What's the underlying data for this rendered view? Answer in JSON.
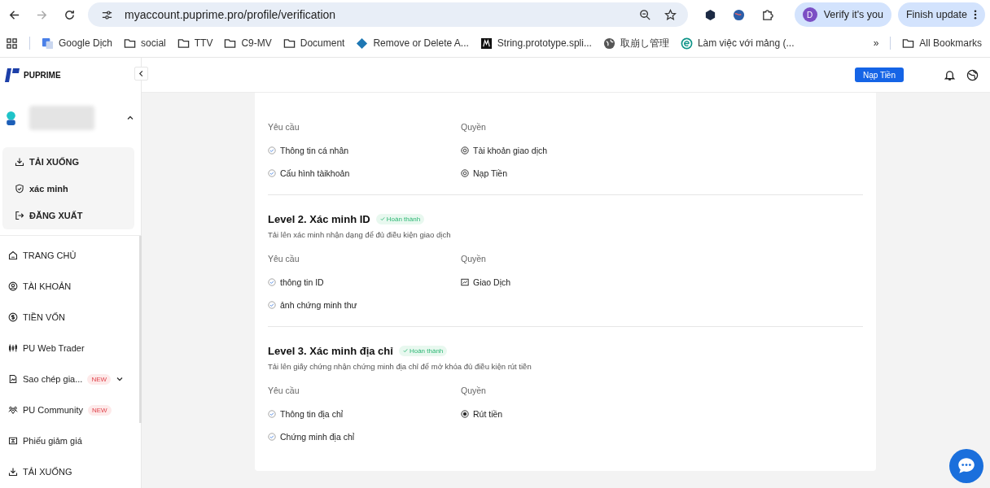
{
  "browser": {
    "url": "myaccount.puprime.pro/profile/verification",
    "forward_disabled": true,
    "profile": {
      "initial": "D",
      "label": "Verify it's you"
    },
    "update_label": "Finish update",
    "bookmarks": [
      {
        "kind": "translate",
        "label": "Google Dịch"
      },
      {
        "kind": "folder",
        "label": "social"
      },
      {
        "kind": "folder",
        "label": "TTV"
      },
      {
        "kind": "folder",
        "label": "C9-MV"
      },
      {
        "kind": "folder",
        "label": "Document"
      },
      {
        "kind": "diamond",
        "label": "Remove or Delete A..."
      },
      {
        "kind": "dark",
        "label": "String.prototype.spli..."
      },
      {
        "kind": "globe",
        "label": "取崩し管理"
      },
      {
        "kind": "circle",
        "label": "Làm việc với mảng (..."
      }
    ],
    "overflow": "»",
    "all_bookmarks": "All Bookmarks"
  },
  "sidebar": {
    "brand": "PUPRIME",
    "account_menu_expanded": true,
    "account_menu": [
      {
        "label": "TẢI XUỐNG"
      },
      {
        "label": "xác minh"
      },
      {
        "label": "ĐĂNG XUẤT"
      }
    ],
    "items": [
      {
        "label": "TRANG CHỦ",
        "kind": "link"
      },
      {
        "label": "TÀI KHOẢN",
        "kind": "link"
      },
      {
        "label": "TIỀN VỐN",
        "kind": "link"
      },
      {
        "label": "PU Web Trader",
        "kind": "link"
      },
      {
        "label": "Sao chép gia...",
        "kind": "group",
        "badge": "NEW"
      },
      {
        "label": "PU Community",
        "kind": "link",
        "badge": "NEW"
      },
      {
        "label": "Phiếu giảm giá",
        "kind": "link"
      },
      {
        "label": "TẢI XUỐNG",
        "kind": "link"
      }
    ]
  },
  "topbar": {
    "deposit_button": "Nạp Tiền"
  },
  "levels": [
    {
      "requirements_label": "Yêu cầu",
      "rights_label": "Quyền",
      "requirements": [
        "Thông tin cá nhân",
        "Cấu hình tàikhoản"
      ],
      "rights": [
        "Tài khoản giao dịch",
        "Nạp Tiền"
      ]
    },
    {
      "title": "Level 2. Xác minh ID",
      "status": "Hoàn thành",
      "completed": true,
      "description": "Tải lên xác minh nhận dạng để đủ điều kiện giao dịch",
      "requirements_label": "Yêu cầu",
      "rights_label": "Quyền",
      "requirements": [
        "thông tin ID",
        "ảnh chứng minh thư"
      ],
      "rights": [
        "Giao Dịch"
      ]
    },
    {
      "title": "Level 3. Xác minh địa chỉ",
      "status": "Hoàn thành",
      "completed": true,
      "description": "Tải lên giấy chứng nhận chứng minh địa chỉ để mở khóa đủ điều kiện rút tiền",
      "requirements_label": "Yêu cầu",
      "rights_label": "Quyền",
      "requirements": [
        "Thông tin địa chỉ",
        "Chứng minh địa chỉ"
      ],
      "rights": [
        "Rút tiền"
      ]
    }
  ]
}
